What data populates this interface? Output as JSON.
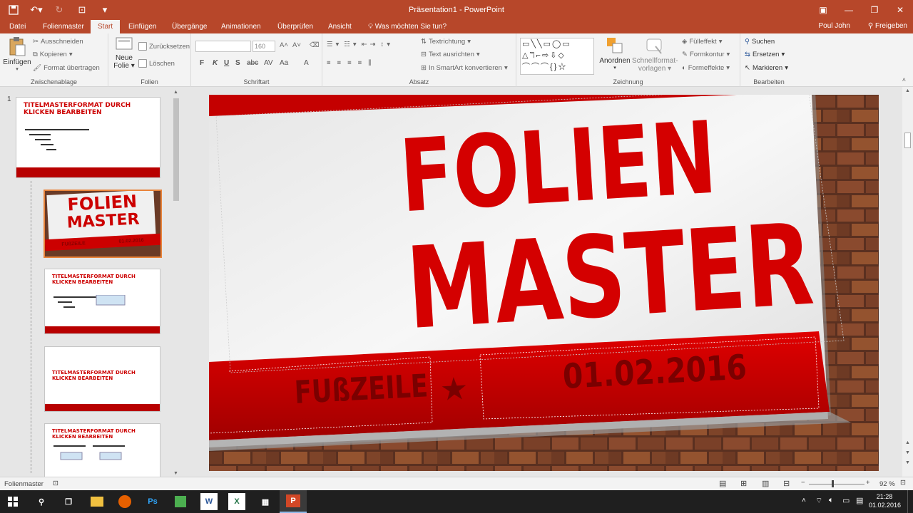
{
  "window": {
    "title": "Präsentation1 - PowerPoint",
    "minimize": "—",
    "restore": "❐",
    "close": "✕",
    "ribbon_toggle": "▣"
  },
  "tabs": [
    "Datei",
    "Folienmaster",
    "Start",
    "Einfügen",
    "Übergänge",
    "Animationen",
    "Überprüfen",
    "Ansicht"
  ],
  "active_tab": "Start",
  "tell_me": "Was möchten Sie tun?",
  "user": "Poul John",
  "share": "Freigeben",
  "ribbon": {
    "zwischenablage": {
      "label": "Zwischenablage",
      "einfuegen": "Einfügen",
      "ausschneiden": "Ausschneiden",
      "kopieren": "Kopieren",
      "format_uebertragen": "Format übertragen"
    },
    "folien": {
      "label": "Folien",
      "neue_folie_1": "Neue",
      "neue_folie_2": "Folie",
      "zuruecksetzen": "Zurücksetzen",
      "loeschen": "Löschen"
    },
    "schriftart": {
      "label": "Schriftart",
      "font_size": "160",
      "bold": "F",
      "italic": "K",
      "underline": "U",
      "strike": "S",
      "abc": "abc",
      "spacing": "AV",
      "case": "Aa",
      "font_color": "A"
    },
    "absatz": {
      "label": "Absatz",
      "textrichtung": "Textrichtung",
      "text_ausrichten": "Text ausrichten",
      "smartart": "In SmartArt konvertieren"
    },
    "zeichnung": {
      "label": "Zeichnung",
      "shapes_row1": "▭╲╲▭◯▭",
      "shapes_row2": "△ℸ⌐⇨⇩◇",
      "shapes_row3": "⌒⌒⌒{}☆",
      "anordnen": "Anordnen",
      "schnellformat_1": "Schnellformat-",
      "schnellformat_2": "vorlagen",
      "fuelleffekt": "Fülleffekt",
      "formkontur": "Formkontur",
      "formeffekte": "Formeffekte"
    },
    "bearbeiten": {
      "label": "Bearbeiten",
      "suchen": "Suchen",
      "ersetzen": "Ersetzen",
      "markieren": "Markieren"
    }
  },
  "thumbnails": {
    "number": "1",
    "master_title": "TITELMASTERFORMAT DURCH KLICKEN BEARBEITEN",
    "layout1_line1": "FOLIEN",
    "layout1_line2": "MASTER",
    "layout1_footer": "FUßZEILE",
    "layout1_date": "01.02.2016"
  },
  "slide": {
    "title_line1": "FOLIEN",
    "title_line2": "MASTER",
    "footer": "FUßZEILE",
    "star": "★",
    "date": "01.02.2016"
  },
  "status": {
    "view": "Folienmaster",
    "zoom": "92 %"
  },
  "taskbar": {
    "time": "21:28",
    "date": "01.02.2016",
    "apps": [
      "Ps",
      "W",
      "X",
      "P"
    ]
  },
  "colors": {
    "accent": "#b7472a",
    "slide_red": "#d40000"
  }
}
